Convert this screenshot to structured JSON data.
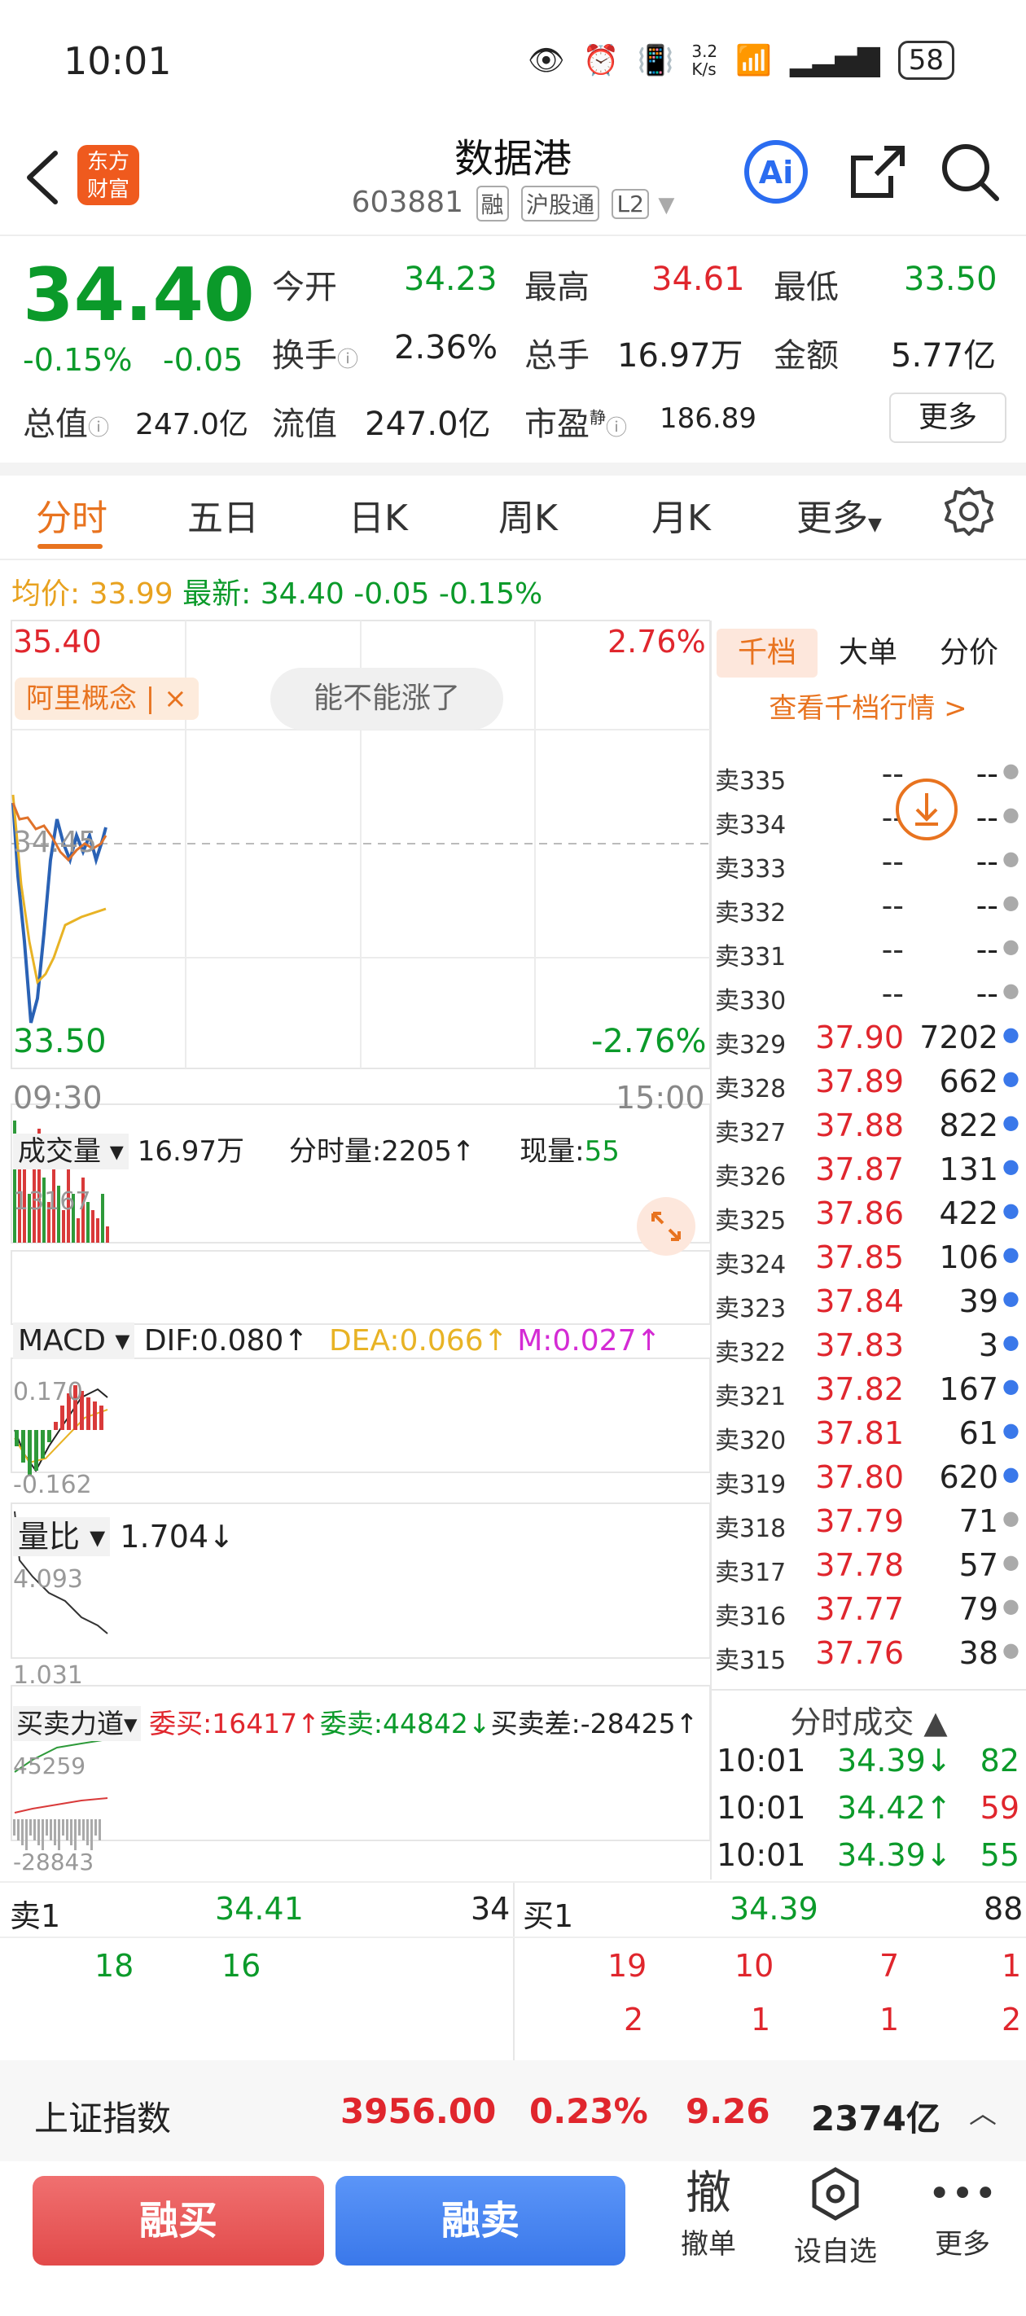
{
  "status": {
    "time": "10:01",
    "speed": "3.2\nK/s",
    "battery": "58"
  },
  "header": {
    "logo_line1": "东方",
    "logo_line2": "财富",
    "title": "数据港",
    "code": "603881",
    "chips": [
      "融",
      "沪股通",
      "L2"
    ]
  },
  "quote": {
    "price": "34.40",
    "change_pct": "-0.15%",
    "change": "-0.05",
    "open_label": "今开",
    "open": "34.23",
    "high_label": "最高",
    "high": "34.61",
    "low_label": "最低",
    "low": "33.50",
    "turnover_label": "换手",
    "turnover": "2.36%",
    "volume_label": "总手",
    "volume": "16.97万",
    "amount_label": "金额",
    "amount": "5.77亿",
    "mktcap_label": "总值",
    "mktcap": "247.0亿",
    "float_label": "流值",
    "float": "247.0亿",
    "pe_label": "市盈",
    "pe_sup": "静",
    "pe": "186.89",
    "more": "更多"
  },
  "tabs": [
    "分时",
    "五日",
    "日K",
    "周K",
    "月K",
    "更多"
  ],
  "avgline": {
    "avg_label": "均价:",
    "avg": "33.99",
    "latest_label": "最新:",
    "latest": "34.40",
    "chg": "-0.05",
    "pct": "-0.15%"
  },
  "chart": {
    "top_price": "35.40",
    "top_pct": "2.76%",
    "mid_price": "34.45",
    "bottom_price": "33.50",
    "bottom_pct": "-2.76%",
    "start_time": "09:30",
    "end_time": "15:00",
    "concept_tag": "阿里概念 | ×",
    "hint_pill": "能不能涨了",
    "vol_label": "成交量",
    "vol_total": "16.97万",
    "vol_minute": "分时量:2205↑",
    "vol_now_label": "现量:",
    "vol_now": "55",
    "vol_max": "13167",
    "macd_label": "MACD",
    "dif": "DIF:0.080↑",
    "dea": "DEA:0.066↑",
    "m": "M:0.027↑",
    "macd_top": "0.170",
    "macd_bottom": "-0.162",
    "lb_label": "量比",
    "lb_value": "1.704↓",
    "lb_top": "4.093",
    "lb_bottom": "1.031",
    "force_label": "买卖力道",
    "wb": "委买:16417↑",
    "ws": "委卖:44842↓",
    "diff": "买卖差:-28425↑",
    "force_top": "45259",
    "force_bottom": "-28843"
  },
  "side": {
    "tabs": [
      "千档",
      "大单",
      "分价"
    ],
    "view_more": "查看千档行情 >",
    "rows": [
      {
        "label": "卖335",
        "price": "--",
        "vol": "--"
      },
      {
        "label": "卖334",
        "price": "--",
        "vol": "--"
      },
      {
        "label": "卖333",
        "price": "--",
        "vol": "--"
      },
      {
        "label": "卖332",
        "price": "--",
        "vol": "--"
      },
      {
        "label": "卖331",
        "price": "--",
        "vol": "--"
      },
      {
        "label": "卖330",
        "price": "--",
        "vol": "--"
      },
      {
        "label": "卖329",
        "price": "37.90",
        "vol": "7202"
      },
      {
        "label": "卖328",
        "price": "37.89",
        "vol": "662"
      },
      {
        "label": "卖327",
        "price": "37.88",
        "vol": "822"
      },
      {
        "label": "卖326",
        "price": "37.87",
        "vol": "131"
      },
      {
        "label": "卖325",
        "price": "37.86",
        "vol": "422"
      },
      {
        "label": "卖324",
        "price": "37.85",
        "vol": "106"
      },
      {
        "label": "卖323",
        "price": "37.84",
        "vol": "39"
      },
      {
        "label": "卖322",
        "price": "37.83",
        "vol": "3"
      },
      {
        "label": "卖321",
        "price": "37.82",
        "vol": "167"
      },
      {
        "label": "卖320",
        "price": "37.81",
        "vol": "61"
      },
      {
        "label": "卖319",
        "price": "37.80",
        "vol": "620"
      },
      {
        "label": "卖318",
        "price": "37.79",
        "vol": "71"
      },
      {
        "label": "卖317",
        "price": "37.78",
        "vol": "57"
      },
      {
        "label": "卖316",
        "price": "37.77",
        "vol": "79"
      },
      {
        "label": "卖315",
        "price": "37.76",
        "vol": "38"
      }
    ],
    "ticks_title": "分时成交",
    "ticks": [
      {
        "time": "10:01",
        "price": "34.39↓",
        "vol": "82"
      },
      {
        "time": "10:01",
        "price": "34.42↑",
        "vol": "59"
      },
      {
        "time": "10:01",
        "price": "34.39↓",
        "vol": "55"
      }
    ]
  },
  "book": {
    "sell_label": "卖1",
    "sell_price": "34.41",
    "sell_vol": "34",
    "buy_label": "买1",
    "buy_price": "34.39",
    "buy_vol": "88",
    "sell_queue": [
      "18",
      "16"
    ],
    "buy_queue_1": [
      "19",
      "10",
      "7",
      "1"
    ],
    "buy_queue_2": [
      "2",
      "1",
      "1",
      "2"
    ]
  },
  "index": {
    "name": "上证指数",
    "value": "3956.00",
    "pct": "0.23%",
    "chg": "9.26",
    "amount": "2374亿"
  },
  "bottom": {
    "buy": "融买",
    "sell": "融卖",
    "cancel_icon": "撤",
    "cancel": "撤单",
    "watch": "设自选",
    "more": "更多"
  }
}
